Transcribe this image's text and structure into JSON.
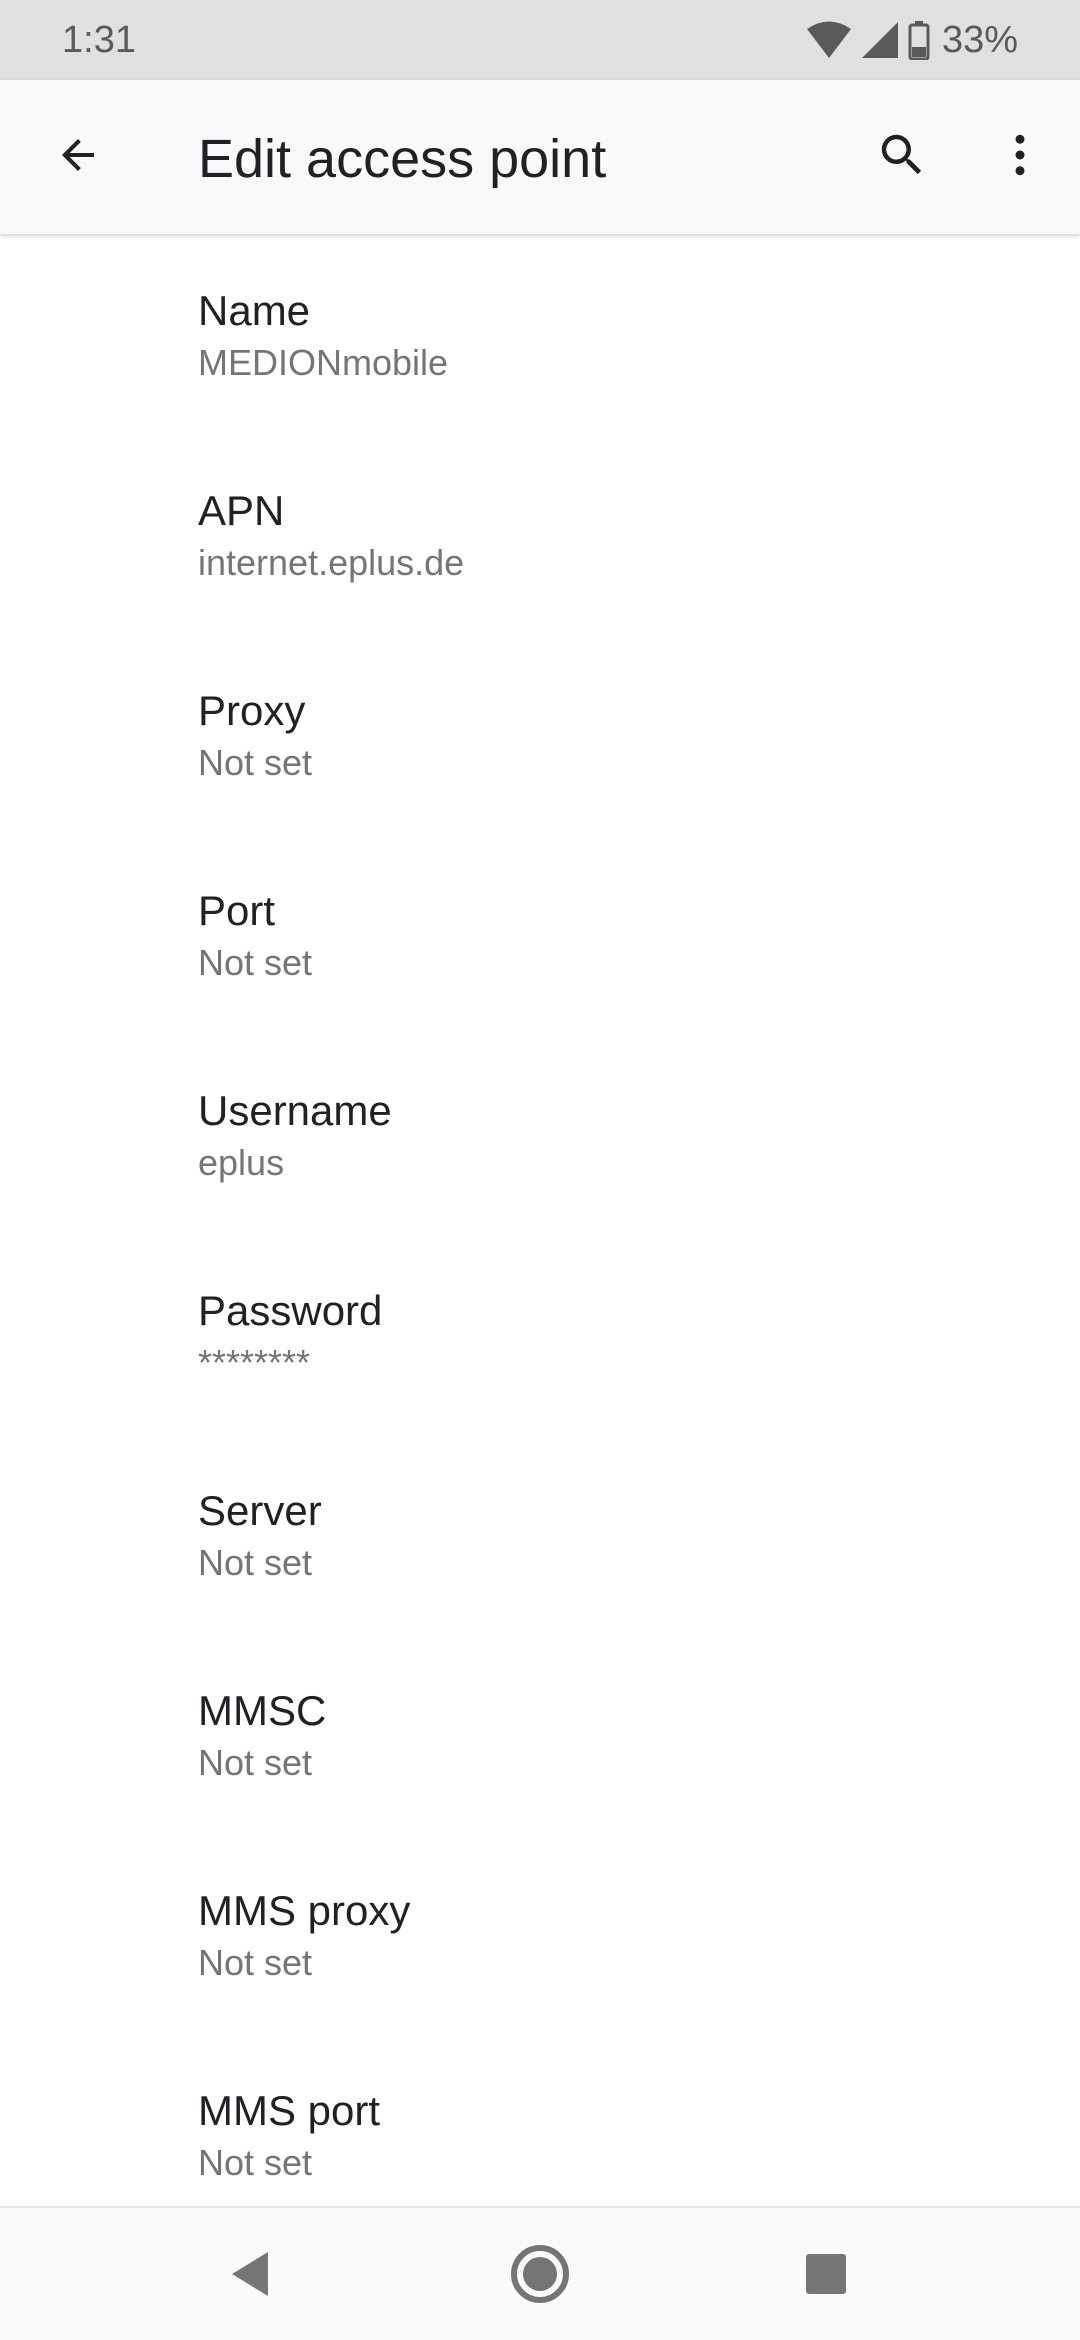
{
  "status_bar": {
    "time": "1:31",
    "battery_percent": "33%",
    "icons": [
      "wifi-icon",
      "cell-signal-icon",
      "battery-icon"
    ]
  },
  "app_bar": {
    "title": "Edit access point",
    "back_icon": "arrow-back-icon",
    "search_icon": "search-icon",
    "more_icon": "more-vert-icon"
  },
  "preferences": [
    {
      "title": "Name",
      "summary": "MEDIONmobile"
    },
    {
      "title": "APN",
      "summary": "internet.eplus.de"
    },
    {
      "title": "Proxy",
      "summary": "Not set"
    },
    {
      "title": "Port",
      "summary": "Not set"
    },
    {
      "title": "Username",
      "summary": "eplus"
    },
    {
      "title": "Password",
      "summary": "********"
    },
    {
      "title": "Server",
      "summary": "Not set"
    },
    {
      "title": "MMSC",
      "summary": "Not set"
    },
    {
      "title": "MMS proxy",
      "summary": "Not set"
    },
    {
      "title": "MMS port",
      "summary": "Not set"
    }
  ],
  "nav_bar": {
    "icons": [
      "nav-back-icon",
      "nav-home-icon",
      "nav-recents-icon"
    ]
  },
  "colors": {
    "status_bar_bg": "#e0e0e0",
    "app_bar_bg": "#f8f9fb",
    "title_text": "#202124",
    "summary_text": "#757575",
    "nav_icon": "#757575"
  }
}
